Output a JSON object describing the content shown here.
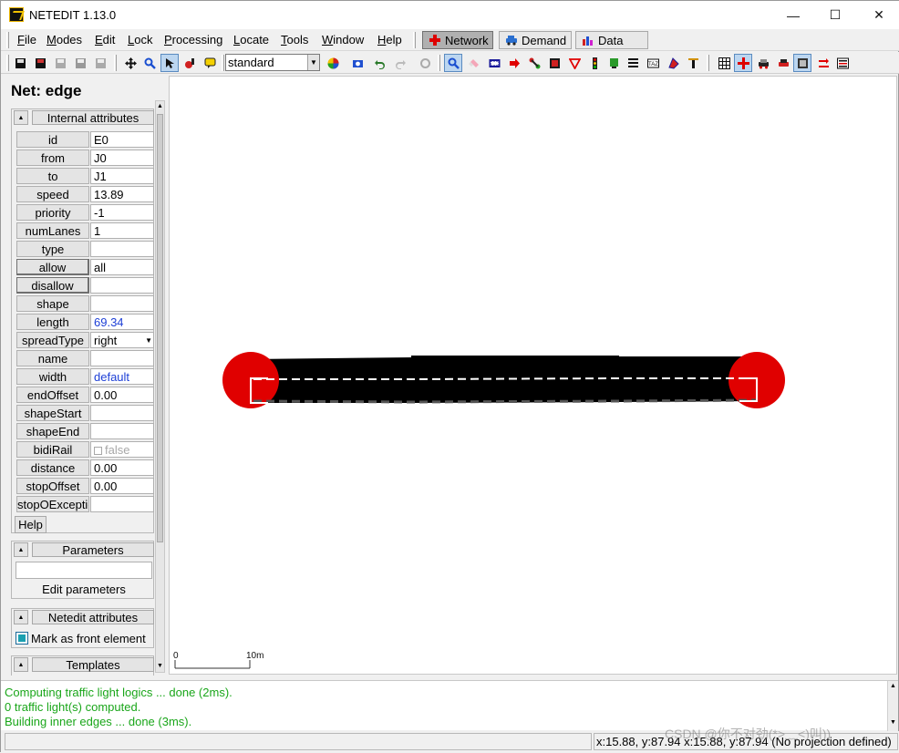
{
  "window": {
    "title": "NETEDIT 1.13.0",
    "minimize": "—",
    "maximize": "☐",
    "close": "✕"
  },
  "menu": [
    "File",
    "Modes",
    "Edit",
    "Lock",
    "Processing",
    "Locate",
    "Tools",
    "Window",
    "Help"
  ],
  "supermodes": [
    {
      "label": "Network",
      "active": true
    },
    {
      "label": "Demand",
      "active": false
    },
    {
      "label": "Data",
      "active": false
    }
  ],
  "toolbar": {
    "scheme": "standard"
  },
  "panel": {
    "title": "Net: edge",
    "internal_header": "Internal attributes",
    "attributes": [
      {
        "label": "id",
        "value": "E0"
      },
      {
        "label": "from",
        "value": "J0"
      },
      {
        "label": "to",
        "value": "J1"
      },
      {
        "label": "speed",
        "value": "13.89"
      },
      {
        "label": "priority",
        "value": "-1"
      },
      {
        "label": "numLanes",
        "value": "1"
      },
      {
        "label": "type",
        "value": ""
      },
      {
        "label": "allow",
        "value": "all"
      },
      {
        "label": "disallow",
        "value": ""
      },
      {
        "label": "shape",
        "value": ""
      },
      {
        "label": "length",
        "value": "69.34"
      },
      {
        "label": "spreadType",
        "value": "right"
      },
      {
        "label": "name",
        "value": ""
      },
      {
        "label": "width",
        "value": "default"
      },
      {
        "label": "endOffset",
        "value": "0.00"
      },
      {
        "label": "shapeStart",
        "value": ""
      },
      {
        "label": "shapeEnd",
        "value": ""
      },
      {
        "label": "bidiRail",
        "value": "false"
      },
      {
        "label": "distance",
        "value": "0.00"
      },
      {
        "label": "stopOffset",
        "value": "0.00"
      },
      {
        "label": "stopOExceptio",
        "value": ""
      }
    ],
    "help": "Help",
    "parameters_header": "Parameters",
    "edit_parameters": "Edit parameters",
    "netedit_header": "Netedit attributes",
    "mark_front": "Mark as front element",
    "templates_header": "Templates"
  },
  "canvas": {
    "scale_start": "0",
    "scale_end": "10m"
  },
  "log": [
    "Computing traffic light logics ... done (2ms).",
    " 0 traffic light(s) computed.",
    "Building inner edges ... done (3ms)."
  ],
  "status": {
    "coords": "x:15.88, y:87.94  x:15.88, y:87.94 (No projection defined)"
  },
  "watermark": "CSDN @你不对劲(*>﹏<)叫))",
  "colors": {
    "junction": "#e00000",
    "edge": "#000000",
    "log_text": "#1aa61a",
    "link_value": "#1d3fd6"
  }
}
